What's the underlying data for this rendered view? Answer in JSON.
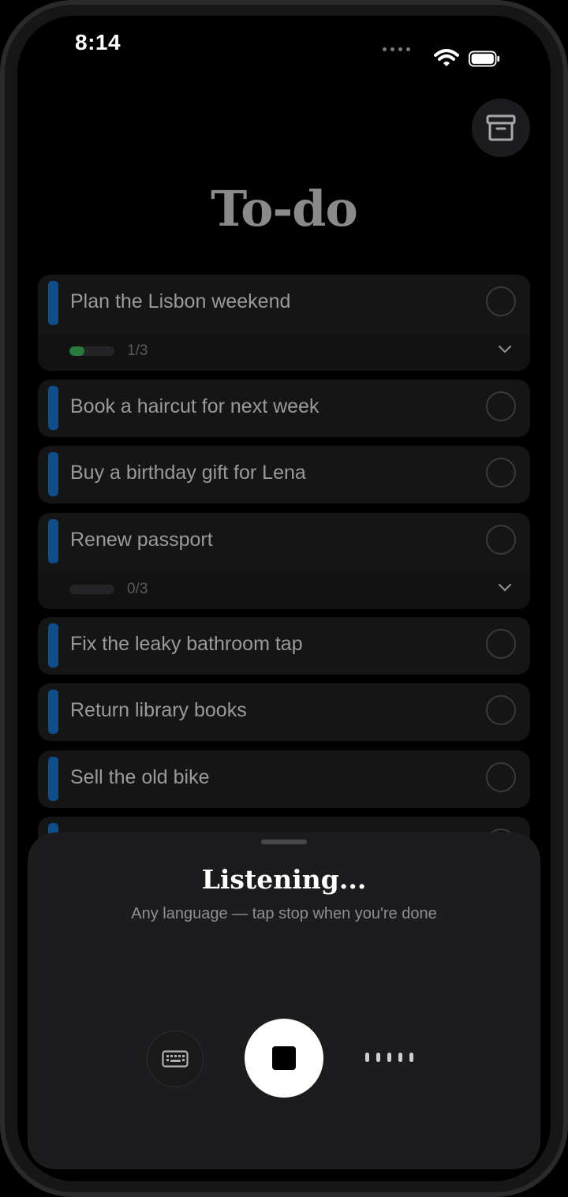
{
  "status_bar": {
    "time": "8:14"
  },
  "header": {
    "title": "To-do",
    "archive_icon": "archive-box-icon"
  },
  "tasks": [
    {
      "label": "Plan the Lisbon weekend",
      "has_subtasks": true,
      "progress_text": "1/3",
      "progress_fraction": 0.33
    },
    {
      "label": "Book a haircut for next week",
      "has_subtasks": false
    },
    {
      "label": "Buy a birthday gift for Lena",
      "has_subtasks": false
    },
    {
      "label": "Renew passport",
      "has_subtasks": true,
      "progress_text": "0/3",
      "progress_fraction": 0
    },
    {
      "label": "Fix the leaky bathroom tap",
      "has_subtasks": false
    },
    {
      "label": "Return library books",
      "has_subtasks": false
    },
    {
      "label": "Sell the old bike",
      "has_subtasks": false
    }
  ],
  "sheet": {
    "title": "Listening...",
    "subtitle": "Any language — tap stop when you're done",
    "keyboard_icon": "keyboard-icon",
    "stop_icon": "stop-icon",
    "waveform_icon": "waveform-icon"
  },
  "colors": {
    "accent_bar": "#0d4f8c",
    "progress_fill": "#2a7a3e",
    "background": "#000000"
  }
}
